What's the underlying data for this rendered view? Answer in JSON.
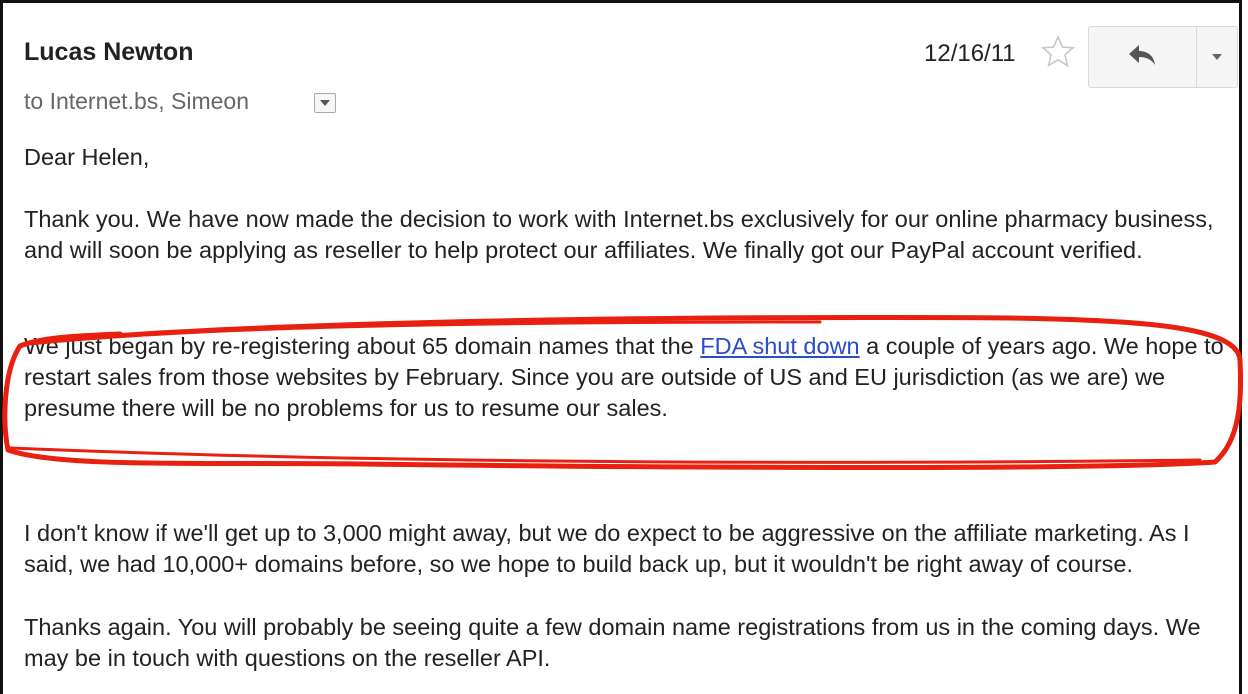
{
  "header": {
    "sender": "Lucas Newton",
    "date": "12/16/11",
    "recipients": "to Internet.bs, Simeon"
  },
  "icons": {
    "star": "star-icon",
    "reply": "reply-icon",
    "more": "chevron-down-icon",
    "recipients_toggle": "dropdown-arrow-icon"
  },
  "message": {
    "greeting": "Dear Helen,",
    "p1": "Thank you. We have now made the decision to work with Internet.bs exclusively for our online pharmacy business, and will soon be applying as reseller to help protect our affiliates. We finally got our PayPal account verified.",
    "p2_before": "We just began by re-registering about 65 domain names that the ",
    "p2_link": "FDA shut down",
    "p2_after": " a couple of years ago. We hope to restart sales from those websites by February. Since you are outside of US and EU jurisdiction (as we are) we presume there will be no problems for us to resume our sales.",
    "p3": "I don't know if we'll get up to 3,000 might away, but we do expect to be aggressive on the affiliate marketing. As I said, we had 10,000+ domains before, so we hope to build back up, but it wouldn't be right away of course.",
    "p4": "Thanks again. You will probably be seeing quite a few domain name registrations from us in the coming days. We may be in touch with questions on the reseller API."
  },
  "colors": {
    "link": "#2a4cc6",
    "annotation": "#e8200f",
    "secondary_text": "#666666"
  }
}
